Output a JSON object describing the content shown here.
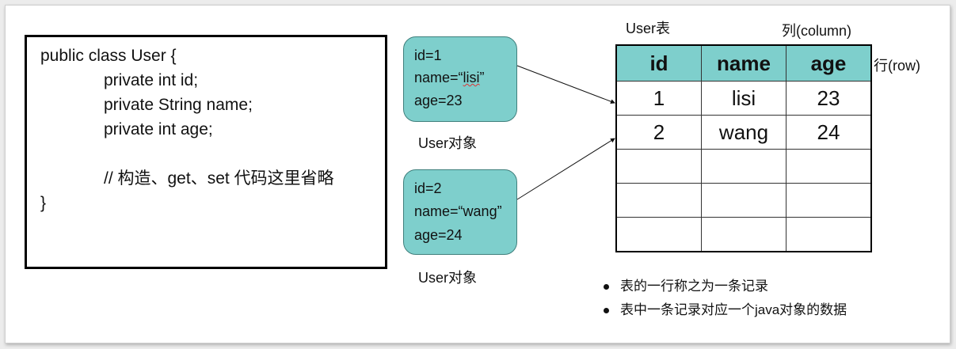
{
  "code": {
    "lines": [
      "public class User {",
      "private int id;",
      "private String name;",
      "private int age;",
      "// 构造、get、set 代码这里省略",
      "}"
    ]
  },
  "objects": [
    {
      "id_line": "id=1",
      "name_prefix": "name=“",
      "name_value": "lisi",
      "name_suffix": "”",
      "age_line": "age=23",
      "caption": "User对象"
    },
    {
      "id_line": "id=2",
      "name_prefix": "name=“",
      "name_value": "wang",
      "name_suffix": "”",
      "age_line": "age=24",
      "caption": "User对象"
    }
  ],
  "table": {
    "title": "User表",
    "column_label": "列(column)",
    "row_label": "行(row)",
    "headers": [
      "id",
      "name",
      "age"
    ],
    "rows": [
      [
        "1",
        "lisi",
        "23"
      ],
      [
        "2",
        "wang",
        "24"
      ],
      [
        "",
        "",
        ""
      ],
      [
        "",
        "",
        ""
      ],
      [
        "",
        "",
        ""
      ]
    ]
  },
  "bullets": [
    "表的一行称之为一条记录",
    "表中一条记录对应一个java对象的数据"
  ],
  "colors": {
    "teal": "#7ecfcc",
    "border": "#000000"
  }
}
